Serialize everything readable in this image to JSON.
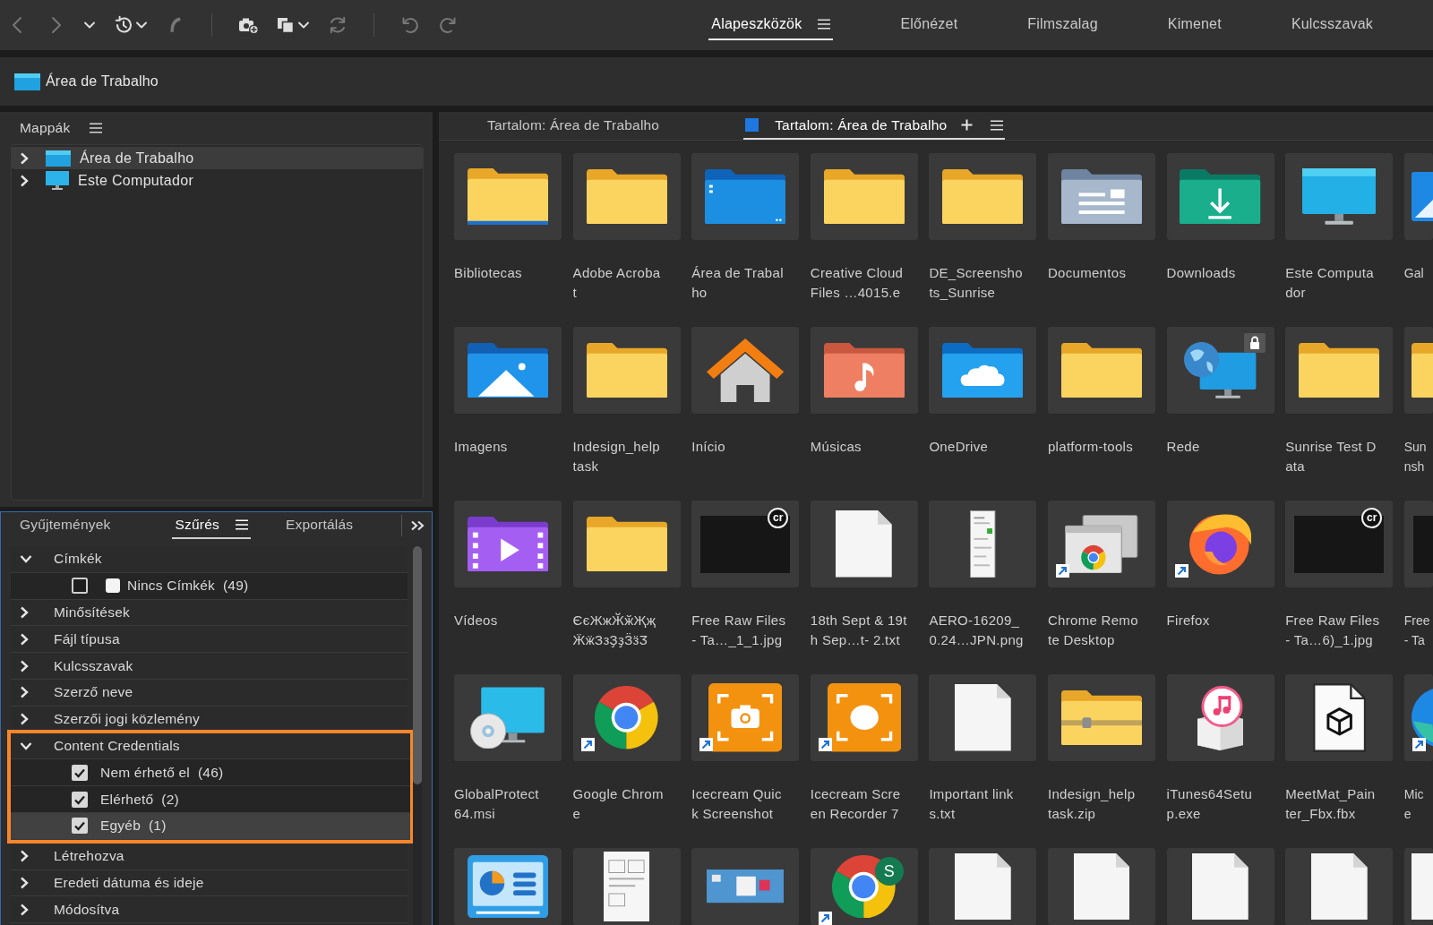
{
  "toolbar": {
    "buttons": [
      {
        "disabled": true
      },
      {
        "disabled": true
      },
      {
        "disabled": false
      },
      {
        "disabled": false
      },
      {
        "disabled": true
      },
      {
        "disabled": false
      },
      {
        "disabled": false
      },
      {
        "disabled": true
      },
      {
        "disabled": true
      },
      {
        "disabled": true
      }
    ]
  },
  "workspace_tabs": [
    {
      "label": "Alapeszközök",
      "selected": true
    },
    {
      "label": "Előnézet",
      "selected": false
    },
    {
      "label": "Filmszalag",
      "selected": false
    },
    {
      "label": "Kimenet",
      "selected": false
    },
    {
      "label": "Kulcsszavak",
      "selected": false
    }
  ],
  "path_bar": {
    "label": "Área de Trabalho"
  },
  "folders_panel": {
    "title": "Mappák",
    "items": [
      {
        "label": "Área de Trabalho",
        "kind": "desktop",
        "selected": true,
        "expanded": false
      },
      {
        "label": "Este Computador",
        "kind": "computer",
        "selected": false,
        "expanded": false
      }
    ]
  },
  "filter_panel": {
    "tabs": [
      {
        "label": "Gyűjtemények",
        "selected": false
      },
      {
        "label": "Szűrés",
        "selected": true
      },
      {
        "label": "Exportálás",
        "selected": false
      }
    ],
    "sections": [
      {
        "label": "Címkék",
        "expanded": true,
        "highlighted": false,
        "options": [
          {
            "label": "Nincs Címkék",
            "count": "(49)",
            "color": "#f4f4f4",
            "checked": false,
            "selected": false
          }
        ]
      },
      {
        "label": "Minősítések",
        "expanded": false,
        "highlighted": false
      },
      {
        "label": "Fájl típusa",
        "expanded": false,
        "highlighted": false
      },
      {
        "label": "Kulcsszavak",
        "expanded": false,
        "highlighted": false
      },
      {
        "label": "Szerző neve",
        "expanded": false,
        "highlighted": false
      },
      {
        "label": "Szerzői jogi közlemény",
        "expanded": false,
        "highlighted": false
      },
      {
        "label": "Content Credentials",
        "expanded": true,
        "highlighted": true,
        "options": [
          {
            "label": "Nem érhető el",
            "count": "(46)",
            "checked": true,
            "selected": false
          },
          {
            "label": "Elérhető",
            "count": "(2)",
            "checked": true,
            "selected": false
          },
          {
            "label": "Egyéb",
            "count": "(1)",
            "checked": true,
            "selected": true
          }
        ]
      },
      {
        "label": "Létrehozva",
        "expanded": false,
        "highlighted": false
      },
      {
        "label": "Eredeti dátuma és ideje",
        "expanded": false,
        "highlighted": false
      },
      {
        "label": "Módosítva",
        "expanded": false,
        "highlighted": false
      }
    ]
  },
  "content_panel": {
    "tabs": [
      {
        "label": "Tartalom: Área de Trabalho",
        "selected": false
      },
      {
        "label": "Tartalom: Área de Trabalho",
        "selected": true
      }
    ],
    "items": [
      {
        "label": [
          "Bibliotecas"
        ],
        "kind": "library",
        "shortcut": false,
        "locked": false
      },
      {
        "label": [
          "Adobe Acroba",
          "t"
        ],
        "kind": "folder",
        "shortcut": false,
        "locked": false
      },
      {
        "label": [
          "Área de Trabal",
          "ho"
        ],
        "kind": "desktop",
        "shortcut": false,
        "locked": false
      },
      {
        "label": [
          "Creative Cloud",
          "Files …4015.e"
        ],
        "kind": "folder",
        "shortcut": false,
        "locked": false
      },
      {
        "label": [
          "DE_Screensho",
          "ts_Sunrise"
        ],
        "kind": "folder",
        "shortcut": false,
        "locked": false
      },
      {
        "label": [
          "Documentos"
        ],
        "kind": "documents",
        "shortcut": false,
        "locked": false
      },
      {
        "label": [
          "Downloads"
        ],
        "kind": "downloads",
        "shortcut": false,
        "locked": false
      },
      {
        "label": [
          "Este Computa",
          "dor"
        ],
        "kind": "computer",
        "shortcut": false,
        "locked": false
      },
      {
        "label": [
          "Gal"
        ],
        "kind": "gallery",
        "shortcut": false,
        "locked": false
      },
      {
        "label": [
          "Imagens"
        ],
        "kind": "pictures",
        "shortcut": false,
        "locked": false
      },
      {
        "label": [
          "Indesign_help",
          "task"
        ],
        "kind": "folder",
        "shortcut": false,
        "locked": false
      },
      {
        "label": [
          "Início"
        ],
        "kind": "home",
        "shortcut": false,
        "locked": false
      },
      {
        "label": [
          "Músicas"
        ],
        "kind": "music",
        "shortcut": false,
        "locked": false
      },
      {
        "label": [
          "OneDrive"
        ],
        "kind": "cloud",
        "shortcut": false,
        "locked": false
      },
      {
        "label": [
          "platform-tools"
        ],
        "kind": "folder",
        "shortcut": false,
        "locked": false
      },
      {
        "label": [
          "Rede"
        ],
        "kind": "network",
        "shortcut": false,
        "locked": true
      },
      {
        "label": [
          "Sunrise Test D",
          "ata"
        ],
        "kind": "folder",
        "shortcut": false,
        "locked": false
      },
      {
        "label": [
          "Sun",
          "nsh"
        ],
        "kind": "folder",
        "shortcut": false,
        "locked": false
      },
      {
        "label": [
          "Vídeos"
        ],
        "kind": "videos",
        "shortcut": false,
        "locked": false
      },
      {
        "label": [
          "ЄєЖжӁӂҖҗ",
          "ӜӝЗзҘҙӞӟӠ"
        ],
        "kind": "folder",
        "shortcut": false,
        "locked": false
      },
      {
        "label": [
          "Free Raw Files",
          "- Ta…_1_1.jpg"
        ],
        "kind": "photo",
        "badge": "cr",
        "shortcut": false,
        "locked": false
      },
      {
        "label": [
          "18th Sept & 19t",
          "h Sep…t- 2.txt"
        ],
        "kind": "text",
        "shortcut": false,
        "locked": false
      },
      {
        "label": [
          "AERO-16209_",
          "0.24…JPN.png"
        ],
        "kind": "screenshot",
        "shortcut": false,
        "locked": false
      },
      {
        "label": [
          "Chrome Remo",
          "te Desktop"
        ],
        "kind": "remote",
        "shortcut": true,
        "locked": false
      },
      {
        "label": [
          "Firefox"
        ],
        "kind": "firefox",
        "shortcut": true,
        "locked": false
      },
      {
        "label": [
          "Free Raw Files",
          "- Ta…6)_1.jpg"
        ],
        "kind": "photo",
        "badge": "cr",
        "shortcut": false,
        "locked": false
      },
      {
        "label": [
          "Free",
          "- Ta"
        ],
        "kind": "photo",
        "shortcut": false,
        "locked": false
      },
      {
        "label": [
          "GlobalProtect",
          "64.msi"
        ],
        "kind": "installer",
        "shortcut": false,
        "locked": false
      },
      {
        "label": [
          "Google Chrom",
          "e"
        ],
        "kind": "chrome",
        "shortcut": true,
        "locked": false
      },
      {
        "label": [
          "Icecream Quic",
          "k Screenshot"
        ],
        "kind": "camera",
        "shortcut": true,
        "locked": false
      },
      {
        "label": [
          "Icecream Scre",
          "en Recorder 7"
        ],
        "kind": "recorder",
        "shortcut": true,
        "locked": false
      },
      {
        "label": [
          "Important link",
          "s.txt"
        ],
        "kind": "text",
        "shortcut": false,
        "locked": false
      },
      {
        "label": [
          "Indesign_help",
          "task.zip"
        ],
        "kind": "zip",
        "shortcut": false,
        "locked": false
      },
      {
        "label": [
          "iTunes64Setu",
          "p.exe"
        ],
        "kind": "itunes",
        "shortcut": false,
        "locked": false
      },
      {
        "label": [
          "MeetMat_Pain",
          "ter_Fbx.fbx"
        ],
        "kind": "model",
        "shortcut": false,
        "locked": false
      },
      {
        "label": [
          "Mic",
          "e"
        ],
        "kind": "edge",
        "shortcut": true,
        "locked": false
      },
      {
        "kind": "diagram",
        "shortcut": false,
        "locked": false
      },
      {
        "kind": "scan",
        "shortcut": false,
        "locked": false
      },
      {
        "kind": "capture",
        "shortcut": false,
        "locked": false
      },
      {
        "kind": "chrome",
        "badge": "S",
        "shortcut": true,
        "locked": false
      },
      {
        "kind": "text",
        "shortcut": false,
        "locked": false
      },
      {
        "kind": "text",
        "shortcut": false,
        "locked": false
      },
      {
        "kind": "text",
        "shortcut": false,
        "locked": false
      },
      {
        "kind": "text",
        "shortcut": false,
        "locked": false
      },
      {
        "kind": "text",
        "shortcut": false,
        "locked": false
      }
    ]
  }
}
